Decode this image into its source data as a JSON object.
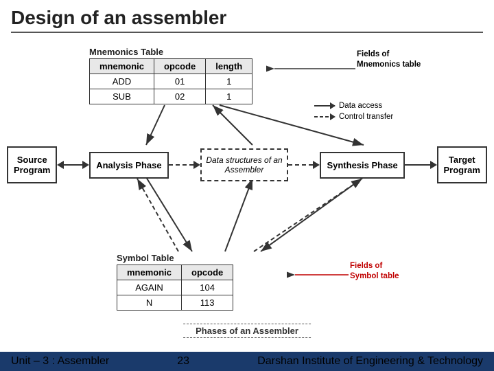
{
  "page": {
    "title": "Design of an assembler"
  },
  "mnemonics_table": {
    "label": "Mnemonics Table",
    "headers": [
      "mnemonic",
      "opcode",
      "length"
    ],
    "rows": [
      {
        "mnemonic": "ADD",
        "opcode": "01",
        "length": "1"
      },
      {
        "mnemonic": "SUB",
        "opcode": "02",
        "length": "1"
      }
    ],
    "fields_label": "Fields of\nMnemonics table"
  },
  "legend": {
    "data_access": "Data access",
    "control_transfer": "Control transfer"
  },
  "flow": {
    "source_program": "Source\nProgram",
    "analysis_phase": "Analysis Phase",
    "data_structures": "Data structures of an\nAssembler",
    "synthesis_phase": "Synthesis Phase",
    "target_program": "Target\nProgram"
  },
  "symbol_table": {
    "label": "Symbol Table",
    "headers": [
      "mnemonic",
      "opcode"
    ],
    "rows": [
      {
        "mnemonic": "AGAIN",
        "opcode": "104"
      },
      {
        "mnemonic": "N",
        "opcode": "113"
      }
    ],
    "fields_label": "Fields of\nSymbol table"
  },
  "phases_label": "Phases of an Assembler",
  "footer": {
    "left": "Unit – 3 : Assembler",
    "center": "23",
    "right": "Darshan Institute of Engineering & Technology"
  }
}
